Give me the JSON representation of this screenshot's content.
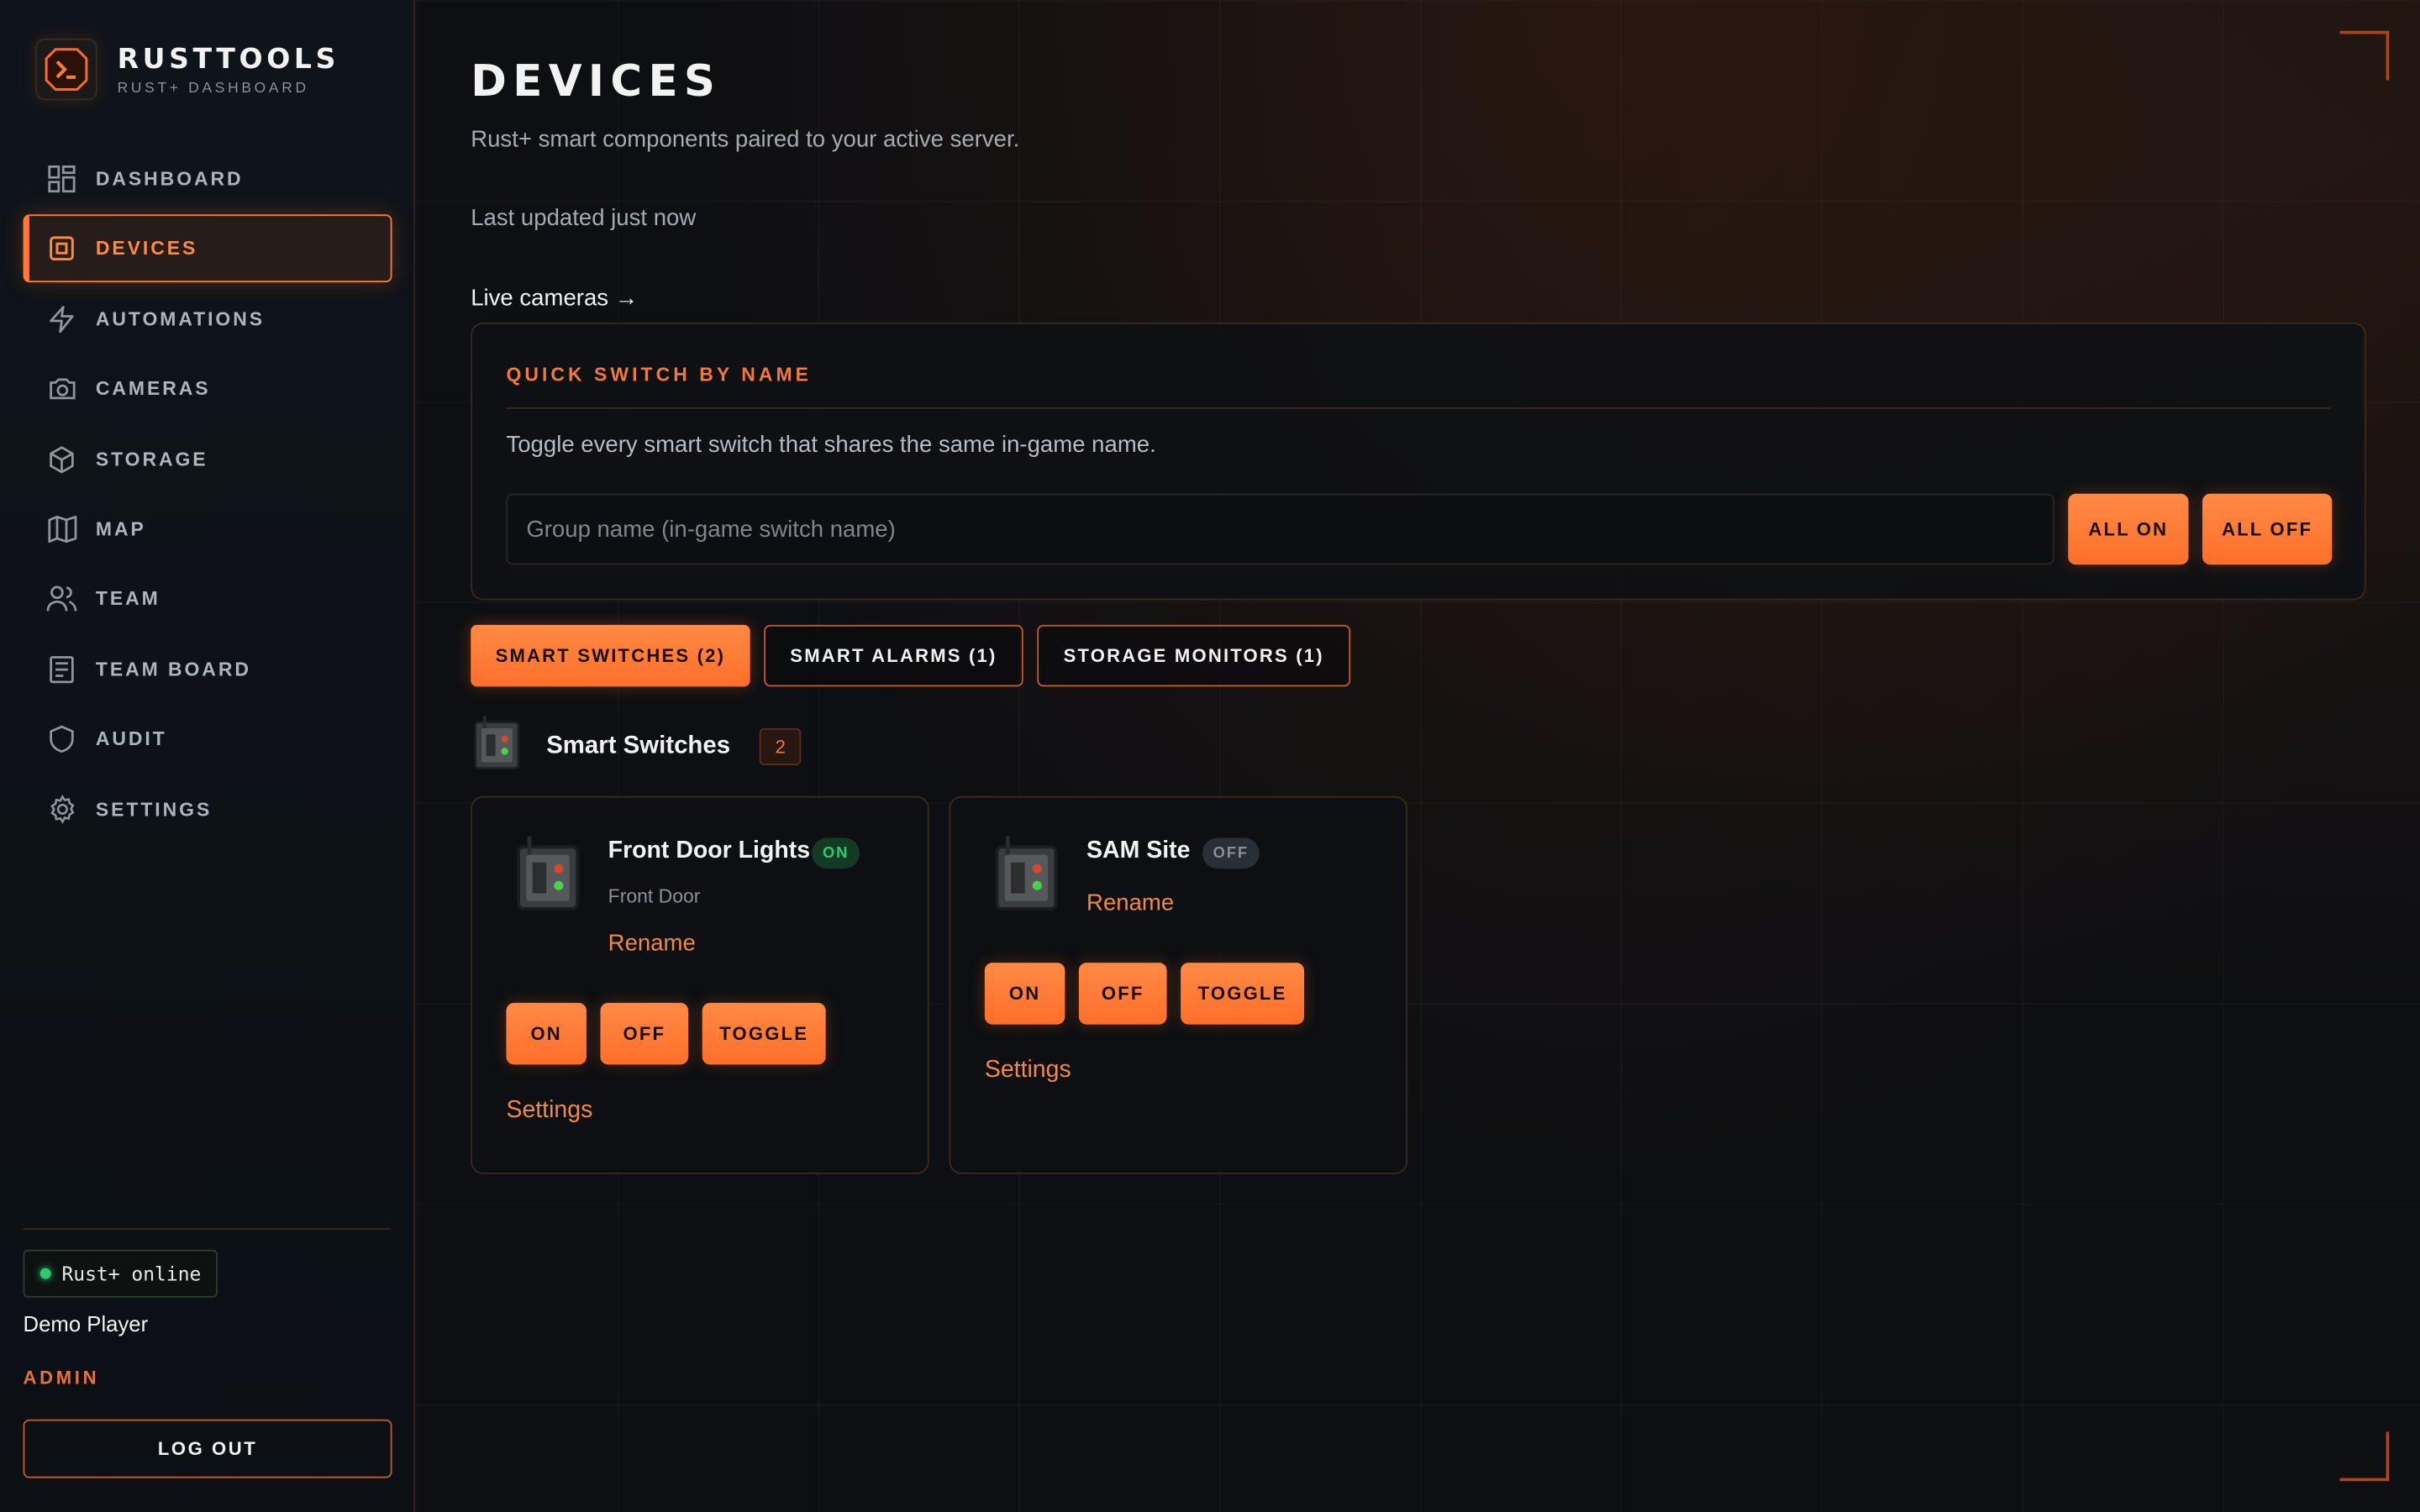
{
  "brand": {
    "title": "RUSTTOOLS",
    "subtitle": "RUST+ DASHBOARD",
    "logo_icon": "terminal-icon"
  },
  "nav": {
    "items": [
      {
        "label": "DASHBOARD",
        "icon": "grid-icon"
      },
      {
        "label": "DEVICES",
        "icon": "chip-icon",
        "active": true
      },
      {
        "label": "AUTOMATIONS",
        "icon": "bolt-icon"
      },
      {
        "label": "CAMERAS",
        "icon": "camera-icon"
      },
      {
        "label": "STORAGE",
        "icon": "box-icon"
      },
      {
        "label": "MAP",
        "icon": "map-icon"
      },
      {
        "label": "TEAM",
        "icon": "users-icon"
      },
      {
        "label": "TEAM BOARD",
        "icon": "board-icon"
      },
      {
        "label": "AUDIT",
        "icon": "shield-icon"
      },
      {
        "label": "SETTINGS",
        "icon": "gear-icon"
      }
    ]
  },
  "footer": {
    "status": "Rust+ online",
    "status_color": "#2ecc71",
    "player_name": "Demo Player",
    "player_role": "ADMIN",
    "logout_label": "LOG OUT"
  },
  "page": {
    "title": "DEVICES",
    "subtitle": "Rust+ smart components paired to your active server.",
    "last_updated": "Last updated just now",
    "live_cameras_link": "Live cameras →"
  },
  "quick_switch": {
    "title": "QUICK SWITCH BY NAME",
    "description": "Toggle every smart switch that shares the same in-game name.",
    "input_placeholder": "Group name (in-game switch name)",
    "input_value": "",
    "all_on_label": "ALL ON",
    "all_off_label": "ALL OFF"
  },
  "tabs": [
    {
      "label": "SMART SWITCHES (2)",
      "active": true
    },
    {
      "label": "SMART ALARMS (1)",
      "active": false
    },
    {
      "label": "STORAGE MONITORS (1)",
      "active": false
    }
  ],
  "section": {
    "title": "Smart Switches",
    "count": "2"
  },
  "devices": [
    {
      "name": "Front Door Lights",
      "state": "ON",
      "group": "Front Door",
      "rename_label": "Rename",
      "on_label": "ON",
      "off_label": "OFF",
      "toggle_label": "TOGGLE",
      "settings_label": "Settings"
    },
    {
      "name": "SAM Site",
      "state": "OFF",
      "rename_label": "Rename",
      "on_label": "ON",
      "off_label": "OFF",
      "toggle_label": "TOGGLE",
      "settings_label": "Settings"
    }
  ],
  "colors": {
    "accent": "#ff7a33",
    "background": "#0e0f12",
    "status_on": "#2ecc71"
  }
}
